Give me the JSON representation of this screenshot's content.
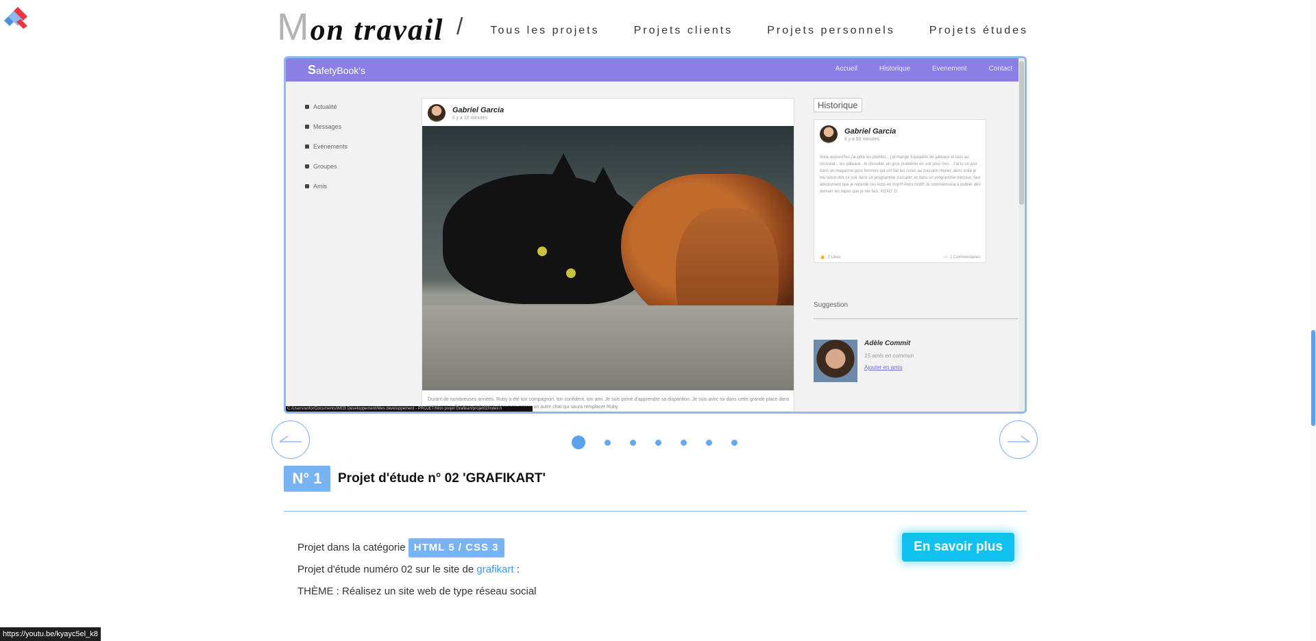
{
  "header": {
    "title_initial": "M",
    "title_rest": "on travail",
    "title_slash": "/",
    "filters": [
      "Tous les projets",
      "Projets clients",
      "Projets personnels",
      "Projets études"
    ]
  },
  "preview": {
    "brand_initial": "S",
    "brand_rest": "afetyBook's",
    "nav_links": [
      "Accueil",
      "Historique",
      "Evenement",
      "Contact"
    ],
    "sidebar": [
      "Actualité",
      "Messages",
      "Evénements",
      "Groupes",
      "Amis"
    ],
    "post": {
      "author": "Gabriel Garcia",
      "time": "Il y a 10 minutes",
      "text": "Durant de nombreuses années, Ruby a été ton compagnon, ton confident, ton ami. Je suis peiné d'apprendre sa disparition. Je suis avec toi dans cette grande place dans notre coeur. Comme un humain, il ny aura jamais un autre chat qui saura remplacer Ruby."
    },
    "history": {
      "label": "Historique",
      "author": "Gabriel Garcia",
      "time": "Il y a 50 minutes",
      "text": "Voila aujourd'hui j'ai pété les plombs... j'ai mangé 3 paquets de gâteaux et tous au chocolat... les gâteaux , le chocolat, un gros problème en soit pour moi... J'ai lu un jour dans un magazine pour femmes qui ont fait les cures au zuccarin murier, alors voilà je me lance dès ce soir dans un programme zuccarin, et dans un programme minceur, faut absolument que je reperde ces kilos en trop!!! Alors motif! Je commencerai à publier dès demain les repas que je me fais. XOXO :D",
      "likes": "2 Likes",
      "comments": "1 Commentaires"
    },
    "suggestion": {
      "label": "Suggestion",
      "name": "Adèle Commit",
      "common": "15 amis en commun",
      "add": "Ajouter en amis"
    },
    "path": "C:/Users/anfor/Documents/WEB Développement/Mes développement - PROJET/Mon projet Grafikart/projet02/index.h"
  },
  "slider": {
    "prev_icon": "arrow-left-icon",
    "next_icon": "arrow-right-icon",
    "dot_count": 7,
    "active_dot": 1
  },
  "project": {
    "number_label": "N° 1",
    "title": "Projet d'étude n° 02 'GRAFIKART'",
    "category_prefix": "Projet dans la catégorie",
    "category_tag": "HTML 5 / CSS 3",
    "site_prefix": "Projet d'étude numéro 02 sur le site de",
    "site_link": "grafikart",
    "site_suffix": ":",
    "theme": "THÈME : Réalisez un site web de type réseau social",
    "more_button": "En savoir plus"
  },
  "status_bar": {
    "url": "https://youtu.be/kyayc5el_k8"
  },
  "colors": {
    "accent": "#78b3f4",
    "button": "#10c1ef",
    "preview_nav": "#8b7fe6"
  }
}
